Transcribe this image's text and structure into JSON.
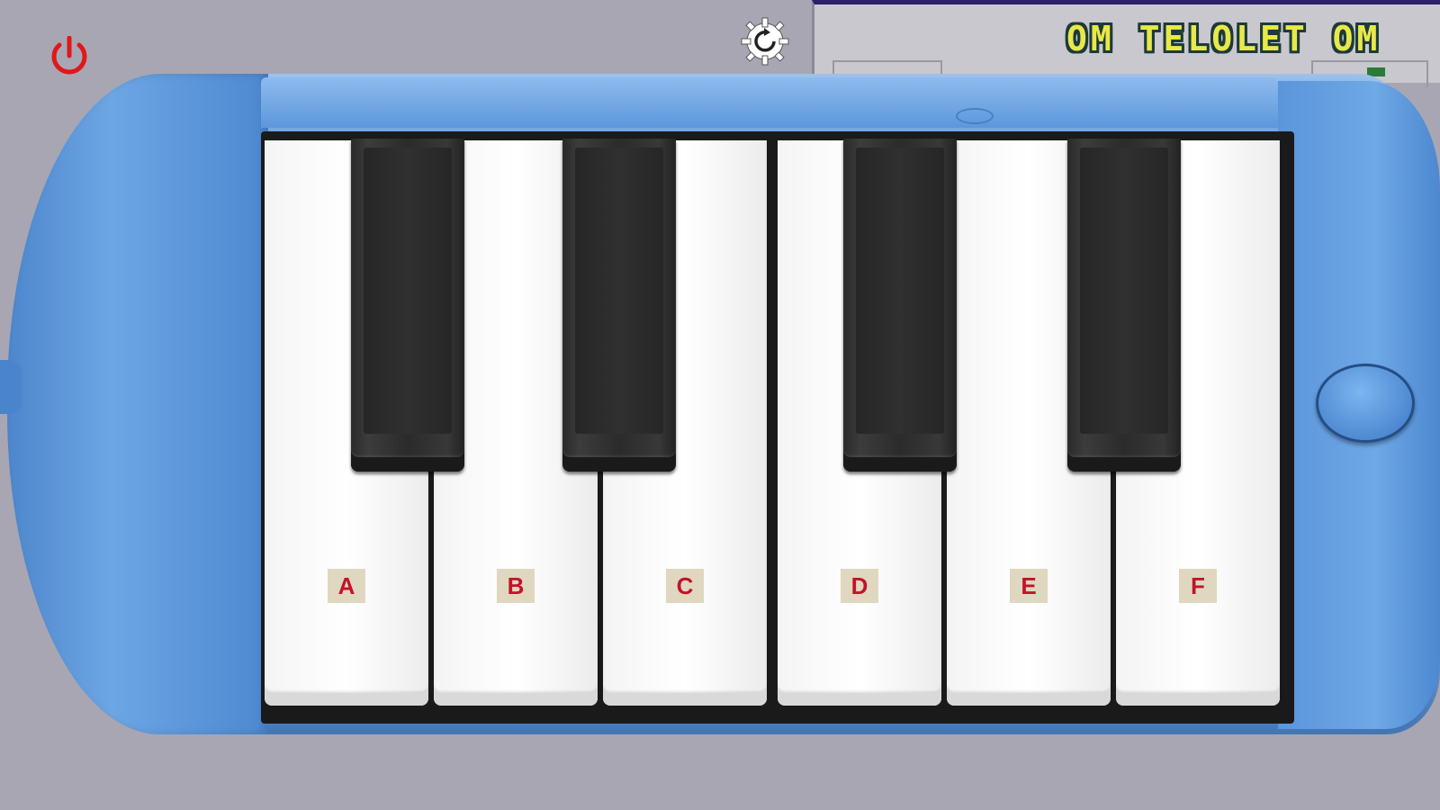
{
  "app": {
    "title": "OM TELOLET OM"
  },
  "controls": {
    "power_icon": "power-icon",
    "power_color": "#e01818",
    "reset_icon": "gear-refresh-icon",
    "blow_button_icon": "mouthpiece-button"
  },
  "keyboard": {
    "white_keys": [
      {
        "label": "A"
      },
      {
        "label": "B"
      },
      {
        "label": "C"
      },
      {
        "label": "D"
      },
      {
        "label": "E"
      },
      {
        "label": "F"
      }
    ],
    "black_key_count": 4
  },
  "colors": {
    "body": "#5b95db",
    "background": "#a8a6b3",
    "label_text": "#c0142a",
    "label_bg": "#e0d7c0",
    "title": "#e8e84a"
  }
}
